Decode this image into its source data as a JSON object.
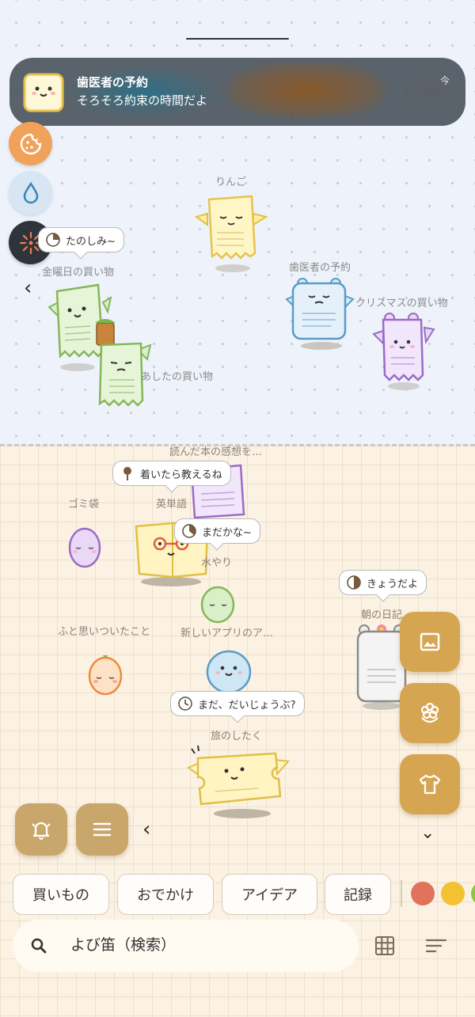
{
  "notification": {
    "title": "歯医者の予約",
    "body": "そろそろ約束の時間だよ",
    "time": "今"
  },
  "left_fabs": [
    "cookie-icon",
    "water-drop-icon",
    "fireworks-icon"
  ],
  "top_area": {
    "labels": {
      "ringo": "りんご",
      "kinyobi": "金曜日の買い物",
      "haisha": "歯医者の予約",
      "christmas": "クリスマスの買い物",
      "ashita": "あしたの買い物"
    },
    "bubble_tanoshimi": "たのしみ~"
  },
  "bottom_area": {
    "labels": {
      "yonda": "読んだ本の感想を…",
      "gomi": "ゴミ袋",
      "eitango": "英単語",
      "mizuyari": "水やり",
      "asa": "朝の日記",
      "futo": "ふと思いついたこと",
      "app": "新しいアプリのア…",
      "tabi": "旅のしたく"
    },
    "bubbles": {
      "tsuitara": "着いたら教えるね",
      "madakana": "まだかな~",
      "kyoudayo": "きょうだよ",
      "daijoubu": "まだ、だいじょうぶ?"
    }
  },
  "right_fabs": [
    "image-icon",
    "flower-icon",
    "shirt-icon"
  ],
  "bottom_fabs": [
    "bell-icon",
    "menu-icon"
  ],
  "tags": [
    "買いもの",
    "おでかけ",
    "アイデア",
    "記録"
  ],
  "color_dots": [
    "#e0735a",
    "#f2c233",
    "#8cc63f"
  ],
  "search": {
    "placeholder": "よび笛（検索）"
  },
  "colors": {
    "top_bg": "#eef3fb",
    "bottom_bg": "#fbf2e3",
    "fab_gold": "#d6a552",
    "fab_tan": "#c9a66b"
  }
}
